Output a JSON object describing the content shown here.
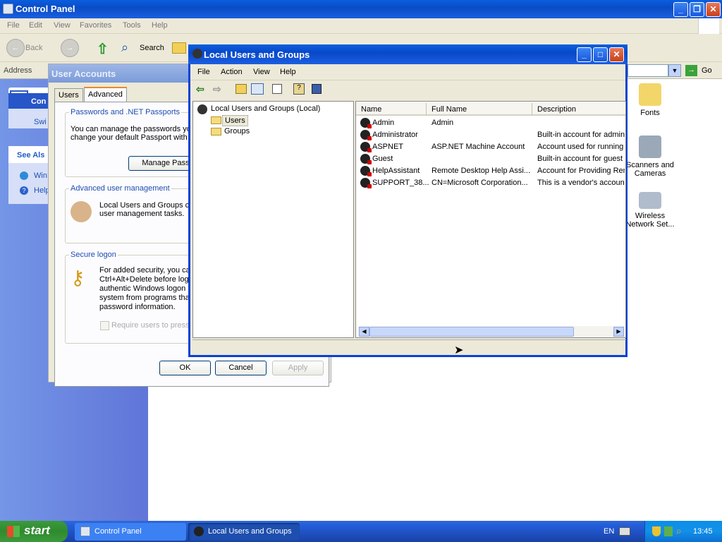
{
  "control_panel": {
    "title": "Control Panel",
    "menu": [
      "File",
      "Edit",
      "View",
      "Favorites",
      "Tools",
      "Help"
    ],
    "toolbar": {
      "back": "Back",
      "search": "Search"
    },
    "address_label": "Address",
    "go": "Go",
    "left": {
      "header_fragment": "Con",
      "item1": "Swi",
      "see_also": "See Als",
      "item2": "Win",
      "item3": "Help"
    },
    "desktop_icons": [
      "Fonts",
      "Scanners and Cameras",
      "Wireless Network Set..."
    ]
  },
  "user_accounts": {
    "title": "User Accounts",
    "tabs": [
      "Users",
      "Advanced"
    ],
    "passwords": {
      "label": "Passwords and .NET Passports",
      "text1": "You can manage the passwords yo",
      "text2": "change your default Passport with",
      "button": "Manage Passwo"
    },
    "advanced": {
      "label": "Advanced user management",
      "text1": "Local Users and Groups ca",
      "text2": "user management tasks."
    },
    "secure": {
      "label": "Secure logon",
      "lines": [
        "For added security, you ca",
        "Ctrl+Alt+Delete before log",
        "authentic Windows logon p",
        "system from programs tha",
        "password information."
      ],
      "checkbox": "Require users to press"
    },
    "buttons": {
      "ok": "OK",
      "cancel": "Cancel",
      "apply": "Apply"
    }
  },
  "lug": {
    "title": "Local Users and Groups",
    "menu": [
      "File",
      "Action",
      "View",
      "Help"
    ],
    "tree": {
      "root": "Local Users and Groups (Local)",
      "users": "Users",
      "groups": "Groups"
    },
    "columns": [
      "Name",
      "Full Name",
      "Description"
    ],
    "rows": [
      {
        "name": "Admin",
        "full": "Admin",
        "desc": ""
      },
      {
        "name": "Administrator",
        "full": "",
        "desc": "Built-in account for adminis"
      },
      {
        "name": "ASPNET",
        "full": "ASP.NET Machine Account",
        "desc": "Account used for running"
      },
      {
        "name": "Guest",
        "full": "",
        "desc": "Built-in account for guest"
      },
      {
        "name": "HelpAssistant",
        "full": "Remote Desktop Help Assi...",
        "desc": "Account for Providing Rem"
      },
      {
        "name": "SUPPORT_38...",
        "full": "CN=Microsoft Corporation...",
        "desc": "This is a vendor's account"
      }
    ]
  },
  "taskbar": {
    "start": "start",
    "tasks": [
      "Control Panel",
      "Local Users and Groups"
    ],
    "lang": "EN",
    "clock": "13:45"
  }
}
